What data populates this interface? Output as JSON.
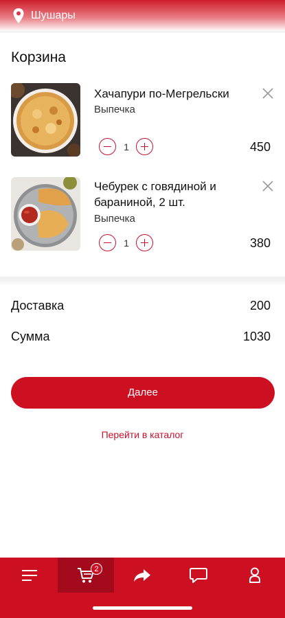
{
  "header": {
    "location": "Шушары"
  },
  "page": {
    "title": "Корзина"
  },
  "cart": {
    "items": [
      {
        "name": "Хачапури по-Мегрельски",
        "category": "Выпечка",
        "quantity": "1",
        "price": "450"
      },
      {
        "name": "Чебурек с говядиной и бараниной, 2 шт.",
        "category": "Выпечка",
        "quantity": "1",
        "price": "380"
      }
    ]
  },
  "summary": {
    "delivery_label": "Доставка",
    "delivery_value": "200",
    "total_label": "Сумма",
    "total_value": "1030"
  },
  "actions": {
    "next_label": "Далее",
    "catalog_link": "Перейти в каталог"
  },
  "nav": {
    "cart_badge": "2",
    "items": [
      "menu-icon",
      "cart-icon",
      "share-icon",
      "chat-icon",
      "profile-icon"
    ]
  },
  "colors": {
    "accent": "#cc1022",
    "accent_dark": "#a30b1c"
  }
}
